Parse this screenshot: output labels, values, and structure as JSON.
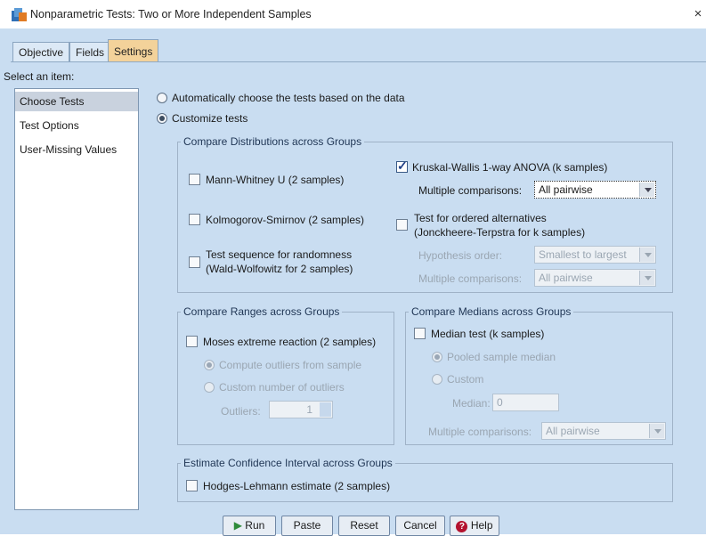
{
  "window": {
    "title": "Nonparametric Tests: Two or More Independent Samples",
    "close_label": "×"
  },
  "tabs": [
    {
      "label": "Objective"
    },
    {
      "label": "Fields"
    },
    {
      "label": "Settings"
    }
  ],
  "sidebar": {
    "heading": "Select an item:",
    "items": [
      {
        "label": "Choose Tests"
      },
      {
        "label": "Test Options"
      },
      {
        "label": "User-Missing Values"
      }
    ]
  },
  "mode": {
    "auto": "Automatically choose the tests based on the data",
    "custom": "Customize tests"
  },
  "distributions": {
    "title": "Compare Distributions across Groups",
    "mann_whitney": "Mann-Whitney U (2 samples)",
    "kolmogorov": "Kolmogorov-Smirnov (2 samples)",
    "runs_1": "Test sequence for randomness",
    "runs_2": "(Wald-Wolfowitz for 2 samples)",
    "kruskal": "Kruskal-Wallis 1-way ANOVA (k samples)",
    "multiple_label": "Multiple comparisons:",
    "multiple_value": "All pairwise",
    "ordered_1": "Test for ordered alternatives",
    "ordered_2": "(Jonckheere-Terpstra for k samples)",
    "hyp_label": "Hypothesis order:",
    "hyp_value": "Smallest to largest",
    "multiple2_label": "Multiple comparisons:",
    "multiple2_value": "All pairwise"
  },
  "ranges": {
    "title": "Compare Ranges across Groups",
    "moses": "Moses extreme reaction (2 samples)",
    "compute": "Compute outliers from sample",
    "custom_n": "Custom number of outliers",
    "outliers_label": "Outliers:",
    "outliers_value": "1"
  },
  "medians": {
    "title": "Compare Medians across Groups",
    "median_test": "Median test (k samples)",
    "pooled": "Pooled sample median",
    "custom": "Custom",
    "median_label": "Median:",
    "median_value": "0",
    "multiple_label": "Multiple comparisons:",
    "multiple_value": "All pairwise"
  },
  "ci": {
    "title": "Estimate Confidence Interval across Groups",
    "hodges": "Hodges-Lehmann estimate (2 samples)"
  },
  "buttons": {
    "run": "Run",
    "paste": "Paste",
    "reset": "Reset",
    "cancel": "Cancel",
    "help": "Help"
  },
  "colors": {
    "accent_tab": "#f3d29a",
    "dialog_bg": "#c9ddf1",
    "run_icon": "#2e8b3a",
    "help_icon": "#b3122e"
  }
}
